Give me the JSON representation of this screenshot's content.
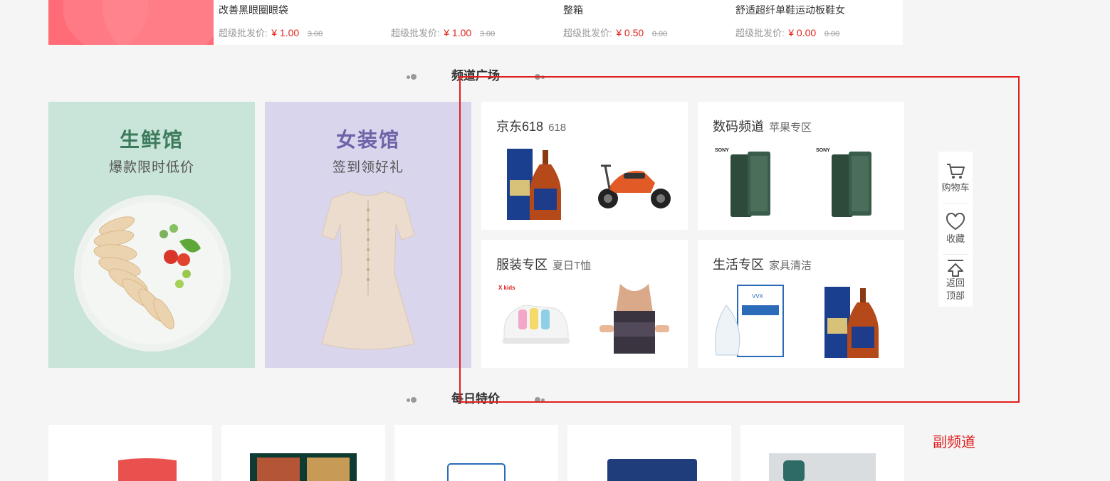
{
  "top_products": [
    {
      "name_top": "",
      "name": "改善黑眼圈眼袋",
      "price_label": "超级批发价:",
      "price_now": "¥ 1.00",
      "price_old": "3.00"
    },
    {
      "name_top": "",
      "name": "",
      "price_label": "超级批发价:",
      "price_now": "¥ 1.00",
      "price_old": "3.00"
    },
    {
      "name_top": "",
      "name": "整箱",
      "price_label": "超级批发价:",
      "price_now": "¥ 0.50",
      "price_old": "0.00"
    },
    {
      "name_top": "",
      "name": "舒适超纤单鞋运动板鞋女",
      "price_label": "超级批发价:",
      "price_now": "¥ 0.00",
      "price_old": "0.00"
    }
  ],
  "channel_square": {
    "title": "频道广场"
  },
  "daily_special": {
    "title": "每日特价"
  },
  "banners": [
    {
      "title": "生鲜馆",
      "subtitle": "爆款限时低价",
      "icon": "chicken-salad-plate"
    },
    {
      "title": "女装馆",
      "subtitle": "签到领好礼",
      "icon": "dress"
    }
  ],
  "channels": [
    {
      "title": "京东618",
      "sub": "618",
      "images": [
        "liquor-bottle",
        "electric-scooter"
      ]
    },
    {
      "title": "数码频道",
      "sub": "苹果专区",
      "images": [
        "sony-phone",
        "sony-phone"
      ]
    },
    {
      "title": "服装专区",
      "sub": "夏日T恤",
      "images": [
        "kids-sneaker",
        "waist-brace"
      ]
    },
    {
      "title": "生活专区",
      "sub": "家具清洁",
      "images": [
        "face-mask",
        "liquor-bottle"
      ]
    }
  ],
  "toolbar": {
    "cart": "购物车",
    "favorite": "收藏",
    "back_top_1": "返回",
    "back_top_2": "顶部"
  },
  "brand_text": {
    "sony": "SONY",
    "xkids": "X kids",
    "vvx": "VVX"
  },
  "annotation": {
    "subchannel": "副频道"
  },
  "colors": {
    "price": "#e1251b",
    "highlight": "#e02020",
    "fresh_bg": "#c9e4d8",
    "women_bg": "#d9d5ec"
  }
}
